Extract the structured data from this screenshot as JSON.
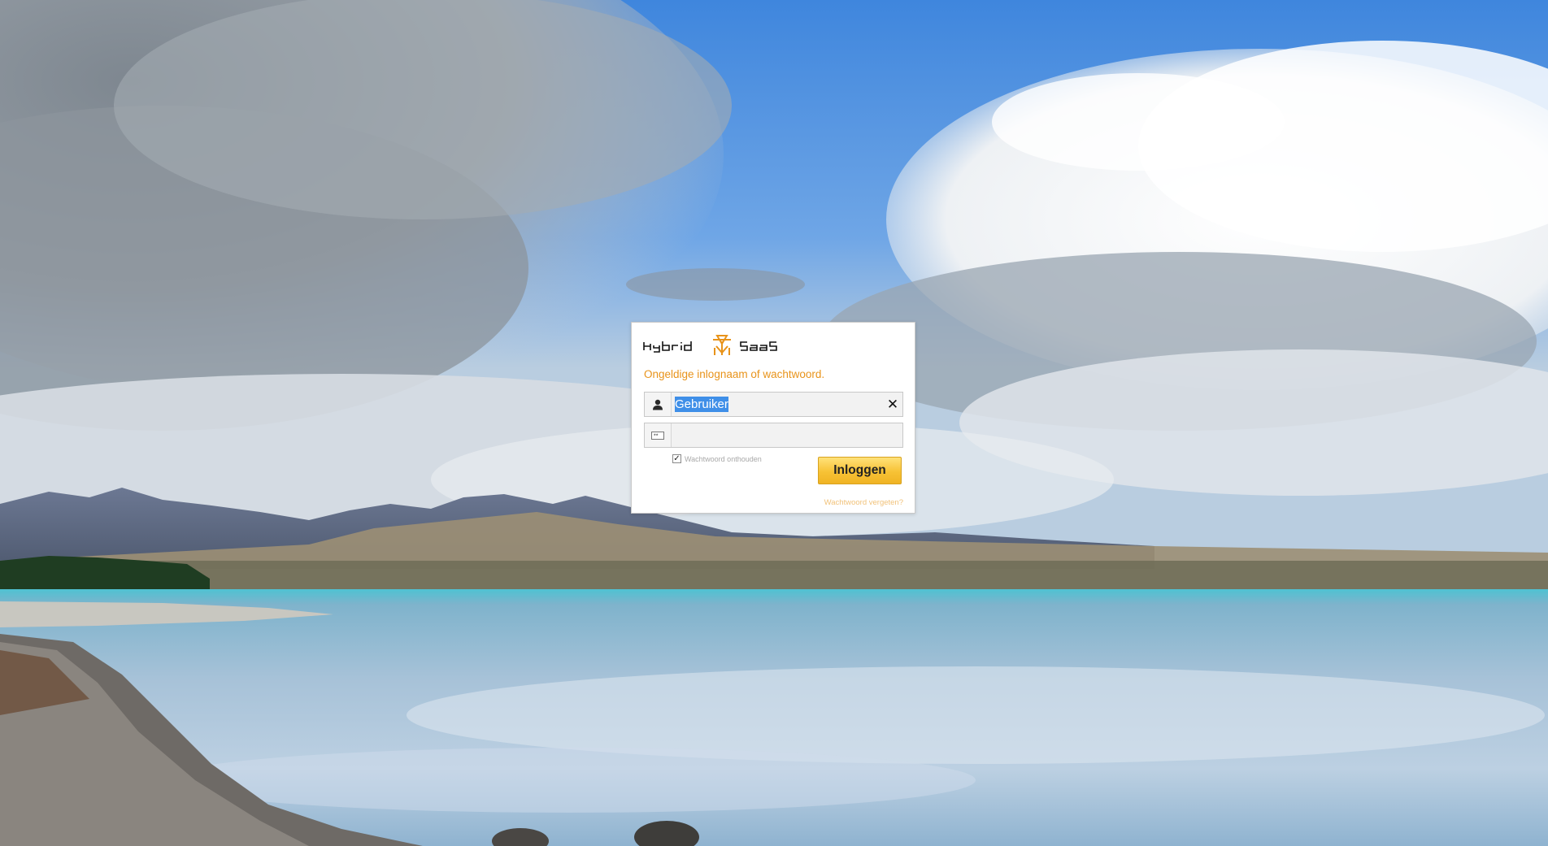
{
  "logo": {
    "brand_left": "Hybrid",
    "brand_right": "SaaS",
    "icon": "hybrid-saas-emblem-icon"
  },
  "login": {
    "error_message": "Ongeldige inlognaam of wachtwoord.",
    "username": {
      "value": "Gebruiker",
      "icon": "user-icon",
      "clear_icon": "close-icon",
      "clear_glyph": "✕"
    },
    "password": {
      "value": "",
      "icon": "password-icon"
    },
    "remember": {
      "label": "Wachtwoord onthouden",
      "checked": true,
      "check_glyph": "✓"
    },
    "submit_label": "Inloggen",
    "forgot_label": "Wachtwoord vergeten?"
  },
  "colors": {
    "accent": "#e8931a",
    "button": "#f7c235",
    "selection": "#3f8fe8"
  }
}
